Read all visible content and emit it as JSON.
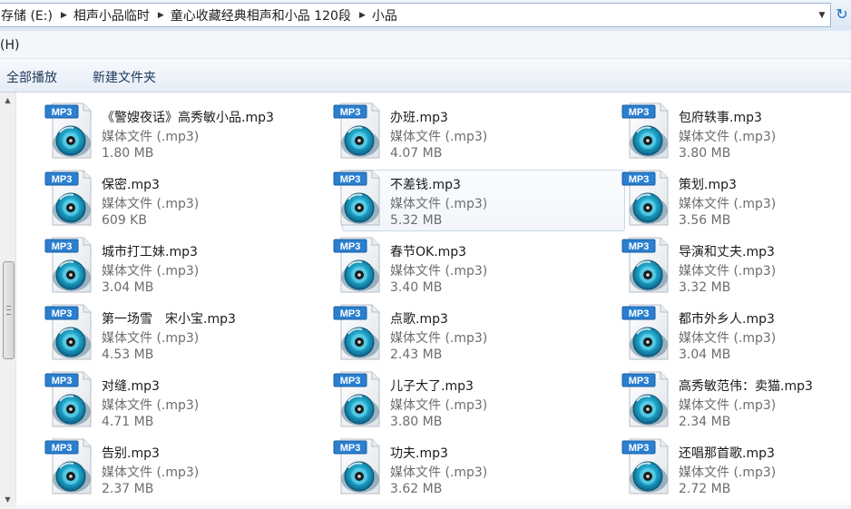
{
  "address_bar": {
    "crumbs": [
      "存储 (E:)",
      "相声小品临时",
      "童心收藏经典相声和小品 120段",
      "小品"
    ]
  },
  "menu": {
    "help_fragment": "(H)"
  },
  "toolbar": {
    "play_all": "全部播放",
    "new_folder": "新建文件夹"
  },
  "icons": {
    "file": "mp3-file-icon",
    "badge_text": "MP3",
    "badge_color": "#2a7fd0",
    "disc_color": "#1fa6c9"
  },
  "files": [
    {
      "name": "《警嫂夜话》高秀敏小品.mp3",
      "type": "媒体文件 (.mp3)",
      "size": "1.80 MB"
    },
    {
      "name": "办班.mp3",
      "type": "媒体文件 (.mp3)",
      "size": "4.07 MB"
    },
    {
      "name": "包府轶事.mp3",
      "type": "媒体文件 (.mp3)",
      "size": "3.80 MB"
    },
    {
      "name": "保密.mp3",
      "type": "媒体文件 (.mp3)",
      "size": "609 KB"
    },
    {
      "name": "不差钱.mp3",
      "type": "媒体文件 (.mp3)",
      "size": "5.32 MB",
      "highlighted": true
    },
    {
      "name": "策划.mp3",
      "type": "媒体文件 (.mp3)",
      "size": "3.56 MB"
    },
    {
      "name": "城市打工妹.mp3",
      "type": "媒体文件 (.mp3)",
      "size": "3.04 MB"
    },
    {
      "name": "春节OK.mp3",
      "type": "媒体文件 (.mp3)",
      "size": "3.40 MB"
    },
    {
      "name": "导演和丈夫.mp3",
      "type": "媒体文件 (.mp3)",
      "size": "3.32 MB"
    },
    {
      "name": "第一场雪　宋小宝.mp3",
      "type": "媒体文件 (.mp3)",
      "size": "4.53 MB"
    },
    {
      "name": "点歌.mp3",
      "type": "媒体文件 (.mp3)",
      "size": "2.43 MB"
    },
    {
      "name": "都市外乡人.mp3",
      "type": "媒体文件 (.mp3)",
      "size": "3.04 MB"
    },
    {
      "name": "对缝.mp3",
      "type": "媒体文件 (.mp3)",
      "size": "4.71 MB"
    },
    {
      "name": "儿子大了.mp3",
      "type": "媒体文件 (.mp3)",
      "size": "3.80 MB"
    },
    {
      "name": "高秀敏范伟：卖猫.mp3",
      "type": "媒体文件 (.mp3)",
      "size": "2.34 MB"
    },
    {
      "name": "告别.mp3",
      "type": "媒体文件 (.mp3)",
      "size": "2.37 MB"
    },
    {
      "name": "功夫.mp3",
      "type": "媒体文件 (.mp3)",
      "size": "3.62 MB"
    },
    {
      "name": "还唱那首歌.mp3",
      "type": "媒体文件 (.mp3)",
      "size": "2.72 MB"
    }
  ]
}
